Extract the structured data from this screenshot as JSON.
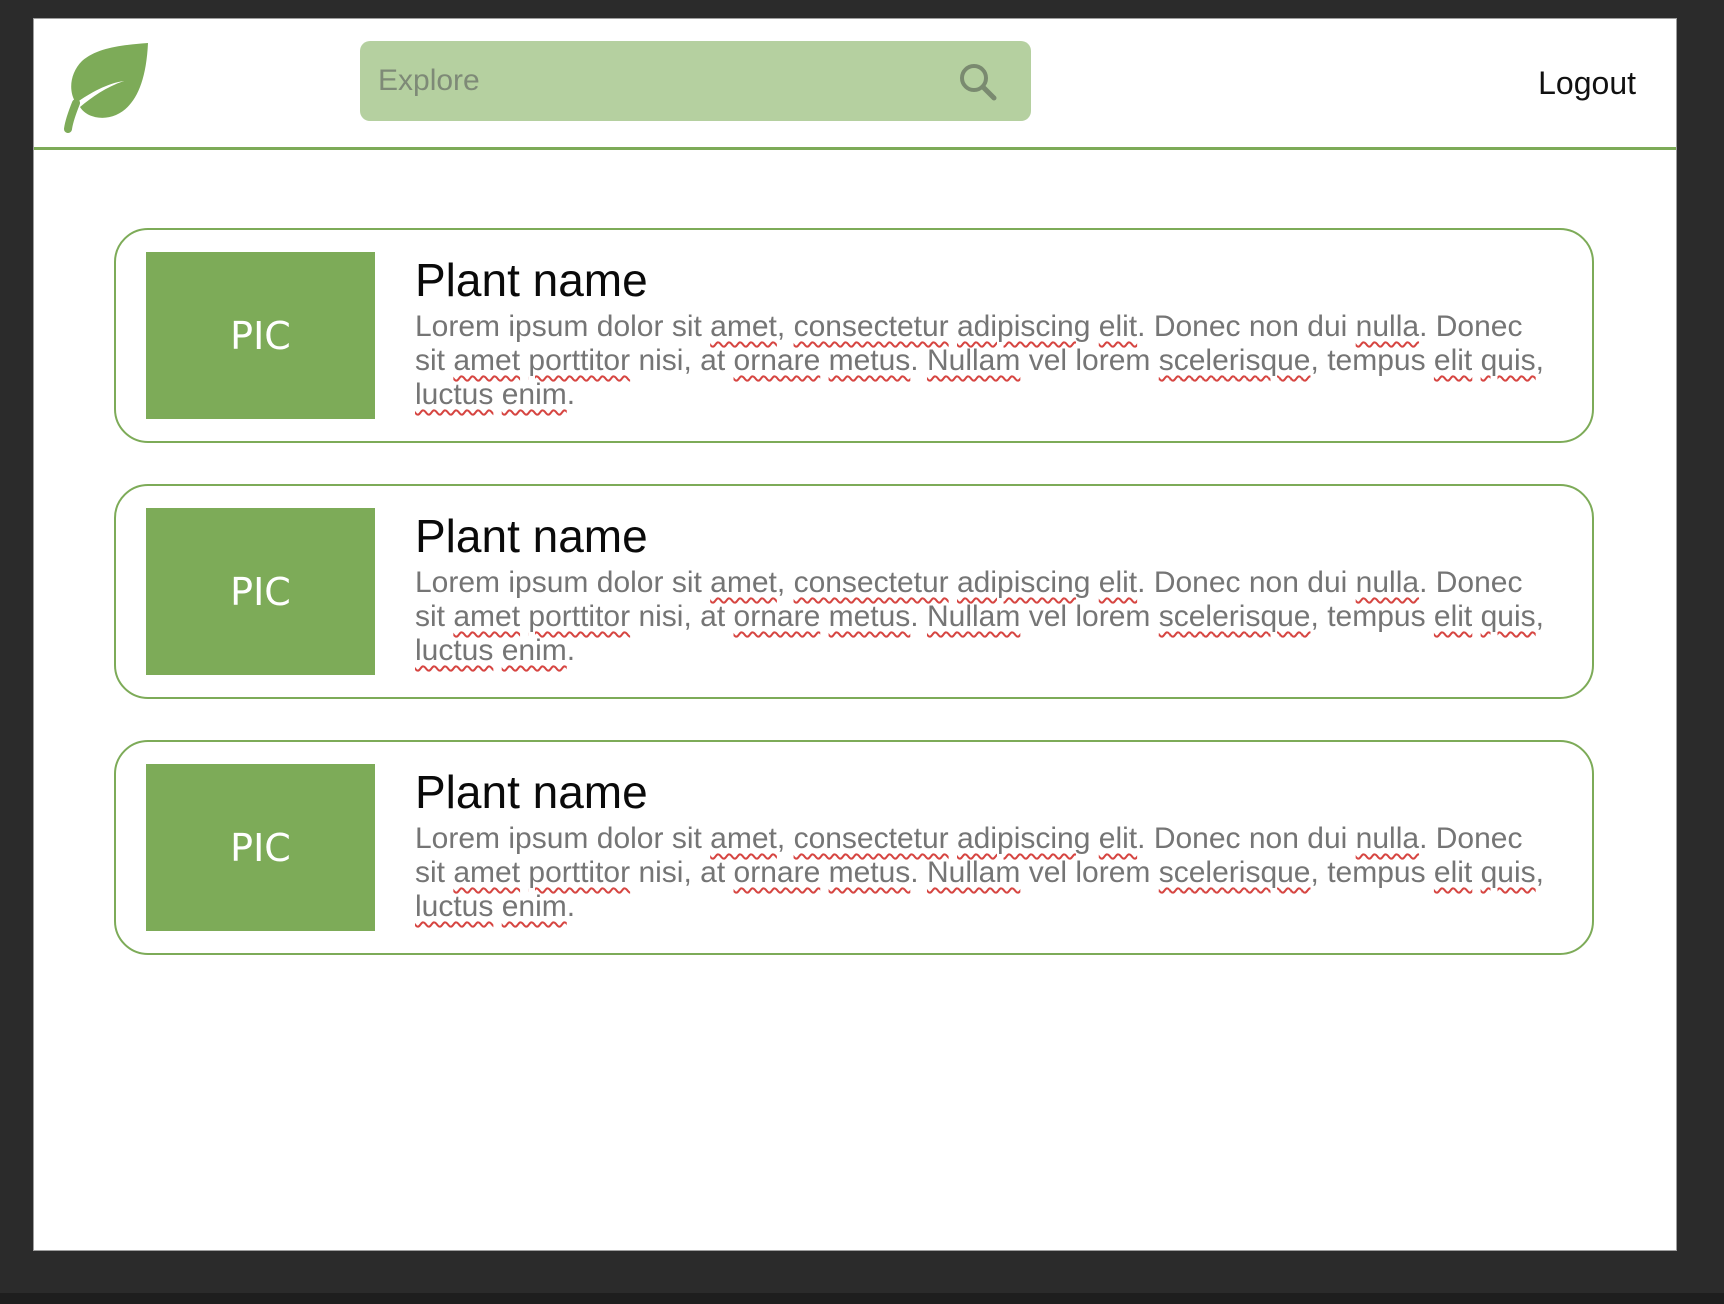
{
  "header": {
    "logo_icon": "leaf-icon",
    "search": {
      "placeholder": "Explore",
      "icon": "search-icon"
    },
    "logout_label": "Logout"
  },
  "colors": {
    "brand_green": "#7dab58",
    "search_bg": "#b5d0a0",
    "spellcheck_red": "#d64541"
  },
  "plants": [
    {
      "image_label": "PIC",
      "name": "Plant name",
      "description": "Lorem ipsum dolor sit amet, consectetur adipiscing elit. Donec non dui nulla. Donec sit amet porttitor nisi, at ornare metus. Nullam vel lorem scelerisque, tempus elit quis, luctus enim."
    },
    {
      "image_label": "PIC",
      "name": "Plant name",
      "description": "Lorem ipsum dolor sit amet, consectetur adipiscing elit. Donec non dui nulla. Donec sit amet porttitor nisi, at ornare metus. Nullam vel lorem scelerisque, tempus elit quis, luctus enim."
    },
    {
      "image_label": "PIC",
      "name": "Plant name",
      "description": "Lorem ipsum dolor sit amet, consectetur adipiscing elit. Donec non dui nulla. Donec sit amet porttitor nisi, at ornare metus. Nullam vel lorem scelerisque, tempus elit quis, luctus enim."
    }
  ],
  "spellcheck_flagged_words": [
    "amet",
    "consectetur",
    "adipiscing",
    "elit",
    "nulla",
    "porttitor",
    "ornare",
    "metus",
    "Nullam",
    "scelerisque",
    "quis",
    "luctus",
    "enim"
  ]
}
